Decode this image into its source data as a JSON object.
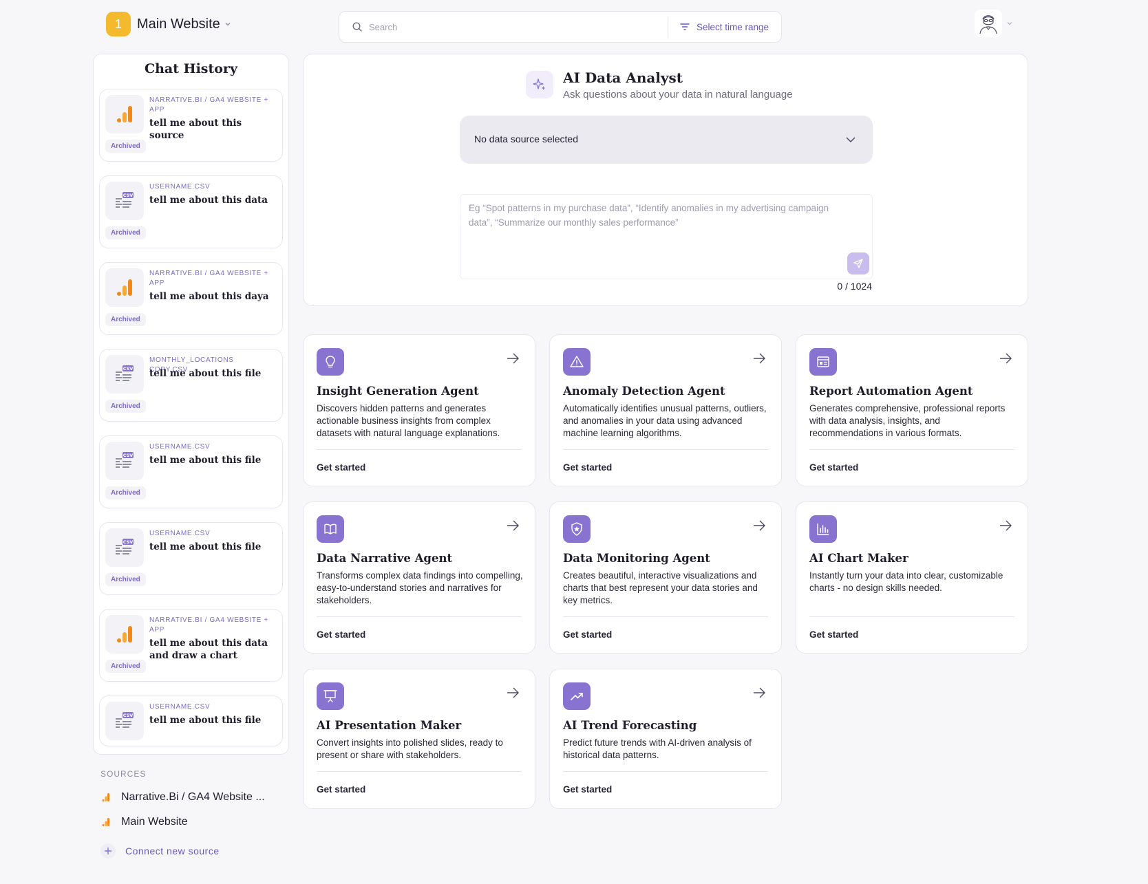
{
  "header": {
    "workspace_number": "1",
    "workspace_name": "Main Website",
    "search_placeholder": "Search",
    "time_range_label": "Select time range"
  },
  "history": {
    "title": "Chat History",
    "items": [
      {
        "source": "NARRATIVE.BI / GA4 WEBSITE + APP",
        "text": "tell me about this source",
        "badge": "Archived",
        "icon": "ga4-chart-icon"
      },
      {
        "source": "USERNAME.CSV",
        "text": "tell me about this data",
        "badge": "Archived",
        "icon": "csv-file-icon"
      },
      {
        "source": "NARRATIVE.BI / GA4 WEBSITE + APP",
        "text": "tell me about this daya",
        "badge": "Archived",
        "icon": "ga4-chart-icon"
      },
      {
        "source": "MONTHLY_LOCATIONS COPY.CSV",
        "text": "tell me about this file",
        "badge": "Archived",
        "icon": "csv-file-icon"
      },
      {
        "source": "USERNAME.CSV",
        "text": "tell me about this file",
        "badge": "Archived",
        "icon": "csv-file-icon"
      },
      {
        "source": "USERNAME.CSV",
        "text": "tell me about this file",
        "badge": "Archived",
        "icon": "csv-file-icon"
      },
      {
        "source": "NARRATIVE.BI / GA4 WEBSITE + APP",
        "text": "tell me about this data and draw a chart",
        "badge": "Archived",
        "icon": "ga4-chart-icon"
      },
      {
        "source": "USERNAME.CSV",
        "text": "tell me about this file",
        "badge": "",
        "icon": "csv-file-icon"
      }
    ],
    "csv_label": "CSV"
  },
  "sources": {
    "label": "SOURCES",
    "items": [
      {
        "name": "Narrative.Bi / GA4 Website ..."
      },
      {
        "name": "Main Website"
      }
    ],
    "connect_label": "Connect new source"
  },
  "analyst": {
    "title": "AI Data Analyst",
    "subtitle": "Ask questions about your data in natural language",
    "data_source_value": "No data source selected",
    "prompt_placeholder": "Eg “Spot patterns in my purchase data”, “Identify anomalies in my advertising campaign data”, “Summarize our monthly sales performance”",
    "counter": "0 / 1024"
  },
  "agents": [
    {
      "title": "Insight Generation Agent",
      "description": "Discovers hidden patterns and generates actionable business insights from complex datasets with natural language explanations.",
      "cta": "Get started",
      "icon": "lightbulb-icon"
    },
    {
      "title": "Anomaly Detection Agent",
      "description": "Automatically identifies unusual patterns, outliers, and anomalies in your data using advanced machine learning algorithms.",
      "cta": "Get started",
      "icon": "warning-triangle-icon"
    },
    {
      "title": "Report Automation Agent",
      "description": "Generates comprehensive, professional reports with data analysis, insights, and recommendations in various formats.",
      "cta": "Get started",
      "icon": "report-icon"
    },
    {
      "title": "Data Narrative Agent",
      "description": "Transforms complex data findings into compelling, easy-to-understand stories and narratives for stakeholders.",
      "cta": "Get started",
      "icon": "open-book-icon"
    },
    {
      "title": "Data Monitoring Agent",
      "description": "Creates beautiful, interactive visualizations and charts that best represent your data stories and key metrics.",
      "cta": "Get started",
      "icon": "shield-star-icon"
    },
    {
      "title": "AI Chart Maker",
      "description": "Instantly turn your data into clear, customizable charts - no design skills needed.",
      "cta": "Get started",
      "icon": "bar-chart-icon"
    },
    {
      "title": "AI Presentation Maker",
      "description": "Convert insights into polished slides, ready to present or share with stakeholders.",
      "cta": "Get started",
      "icon": "presentation-icon"
    },
    {
      "title": "AI Trend Forecasting",
      "description": "Predict future trends with AI-driven analysis of historical data patterns.",
      "cta": "Get started",
      "icon": "trend-up-icon"
    }
  ],
  "colors": {
    "accent": "#8874d0",
    "accent_text": "#6a56c0",
    "workspace_badge": "#f5b92e",
    "ga4_orange": "#f28a1a"
  }
}
